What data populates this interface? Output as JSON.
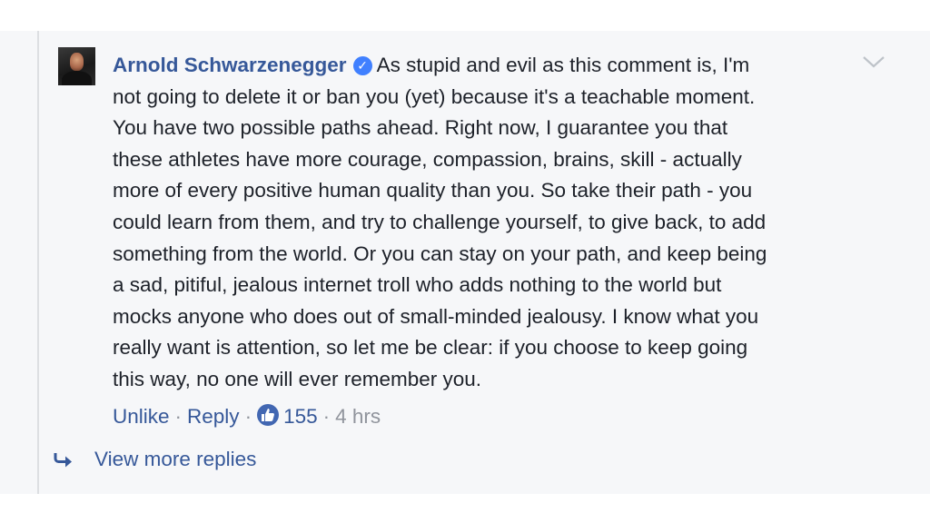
{
  "comment": {
    "author": "Arnold Schwarzenegger",
    "verified_icon": "verified-check-icon",
    "text_lines": [
      "As stupid and evil as this comment is, I'm",
      "not going to delete it or ban you (yet) because it's a teachable moment.",
      "You have two possible paths ahead. Right now, I guarantee you that",
      "these athletes have more courage, compassion, brains, skill - actually",
      "more of every positive human quality than you. So take their path - you",
      "could learn from them, and try to challenge yourself, to give back, to add",
      "something from the world. Or you can stay on your path, and keep being",
      "a sad, pitiful, jealous internet troll who adds nothing to the world but",
      "mocks anyone who does out of small-minded jealousy. I know what you",
      "really want is attention, so let me be clear: if you choose to keep going",
      "this way, no one will ever remember you."
    ]
  },
  "actions": {
    "unlike_label": "Unlike",
    "reply_label": "Reply",
    "separator": "·",
    "like_count": "155",
    "time": "4 hrs"
  },
  "replies": {
    "view_more_label": "View more replies"
  },
  "colors": {
    "link": "#365899",
    "text": "#1d2129",
    "meta": "#90949c",
    "panel_bg": "#f6f7f9",
    "like_blue": "#4267b2"
  }
}
